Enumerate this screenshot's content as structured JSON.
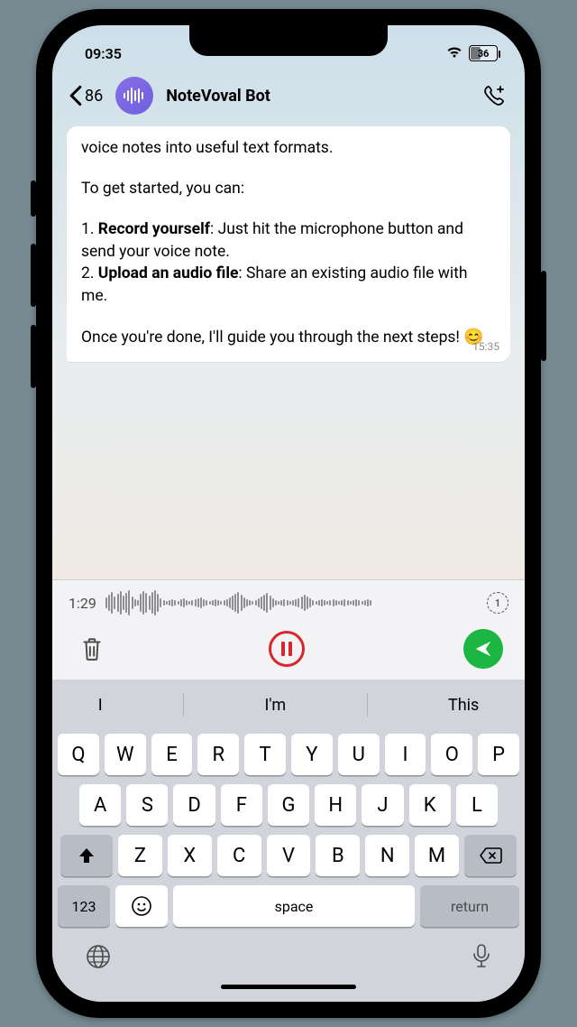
{
  "status": {
    "time": "09:35",
    "battery_percent": "36"
  },
  "header": {
    "back_count": "86",
    "title": "NoteVoval Bot"
  },
  "message": {
    "line1": "voice notes into useful text formats.",
    "line2": "To get started, you can:",
    "item1_bold": "Record yourself",
    "item1_rest": ": Just hit the microphone button and send your voice note.",
    "item2_bold": "Upload an audio file",
    "item2_rest": ": Share an existing audio file with me.",
    "closing": "Once you're done, I'll guide you through the next steps! ",
    "emoji": "😊",
    "timestamp": "15:35"
  },
  "voice": {
    "elapsed": "1:29",
    "timer_seg": "1"
  },
  "suggestions": {
    "s1": "I",
    "s2": "I'm",
    "s3": "This"
  },
  "keys": {
    "row1": [
      "Q",
      "W",
      "E",
      "R",
      "T",
      "Y",
      "U",
      "I",
      "O",
      "P"
    ],
    "row2": [
      "A",
      "S",
      "D",
      "F",
      "G",
      "H",
      "J",
      "K",
      "L"
    ],
    "row3": [
      "Z",
      "X",
      "C",
      "V",
      "B",
      "N",
      "M"
    ],
    "numbers": "123",
    "space": "space",
    "return": "return"
  }
}
